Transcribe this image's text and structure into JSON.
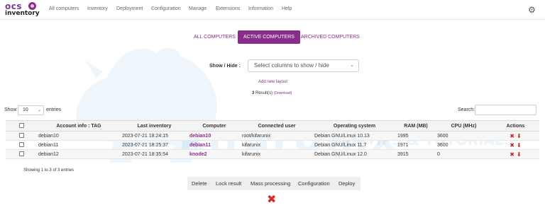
{
  "app": {
    "logo_top": "ocs",
    "logo_bottom": "inventory"
  },
  "nav": {
    "items": [
      "All computers",
      "Inventory",
      "Deployment",
      "Configuration",
      "Manage",
      "Extensions",
      "Information",
      "Help"
    ],
    "settings_icon": "gear-icon"
  },
  "watermark": {
    "brand": "kifarunix",
    "tagline": "NIX TIPS & TUTORIALS"
  },
  "view_tabs": {
    "items": [
      "ALL COMPUTERS",
      "ACTIVE COMPUTERS",
      "ARCHIVED COMPUTERS"
    ],
    "active": "ACTIVE COMPUTERS"
  },
  "show_hide": {
    "label": "Show / Hide :",
    "placeholder": "Select columns to show / hide",
    "add_layout": "Add new layout"
  },
  "results": {
    "count": "3",
    "label": "Result(s)",
    "download": "(Download)"
  },
  "entries": {
    "show_label": "Show",
    "value": "10",
    "after_label": "entries"
  },
  "search": {
    "label": "Search:",
    "value": ""
  },
  "table": {
    "columns": [
      "Account info : TAG",
      "Last inventory",
      "Computer",
      "Connected user",
      "Operating system",
      "RAM (MB)",
      "CPU (MHz)",
      "Actions"
    ],
    "rows": [
      {
        "tag": "debian10",
        "last_inventory": "2023-07-21 18:24:15",
        "computer": "debian10",
        "user": "root/kifarunix",
        "os": "Debian GNU/Linux 10.13",
        "ram": "1995",
        "cpu": "3600"
      },
      {
        "tag": "debian11",
        "last_inventory": "2023-07-21 18:25:37",
        "computer": "debian11",
        "user": "kifarunix",
        "os": "Debian GNU/Linux 11.7",
        "ram": "1971",
        "cpu": "3600"
      },
      {
        "tag": "debian12",
        "last_inventory": "2023-07-21 18:35:54",
        "computer": "knode2",
        "user": "kifarunix",
        "os": "Debian GNU/Linux 12.0",
        "ram": "3915",
        "cpu": "0"
      }
    ],
    "row_actions": [
      "delete-icon",
      "download-icon"
    ]
  },
  "footer": {
    "showing": "Showing 1 to 3 of 3 entries"
  },
  "action_bar": {
    "buttons": [
      "Delete",
      "Lock result",
      "Mass processing",
      "Configuration",
      "Deploy"
    ]
  },
  "colors": {
    "accent": "#8a2d8a",
    "danger": "#c1272d",
    "watermark": "#3d8bd4"
  }
}
